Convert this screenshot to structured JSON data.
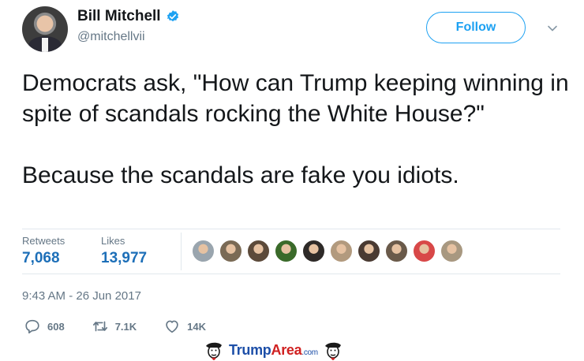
{
  "author": {
    "name": "Bill Mitchell",
    "handle": "@mitchellvii",
    "verified": true
  },
  "follow_label": "Follow",
  "tweet": {
    "paragraph1": "Democrats ask, \"How can Trump keeping winning in spite of scandals rocking the White House?\"",
    "paragraph2": "Because the scandals are fake you idiots."
  },
  "stats": {
    "retweets_label": "Retweets",
    "retweets_value": "7,068",
    "likes_label": "Likes",
    "likes_value": "13,977"
  },
  "liker_avatar_colors": [
    "#9aa5ae",
    "#7a6a55",
    "#5c4a3a",
    "#3a6a2a",
    "#2e2a28",
    "#b29a7e",
    "#4a3a32",
    "#6a5a4a",
    "#d84848",
    "#a89880"
  ],
  "timestamp": "9:43 AM - 26 Jun 2017",
  "actions": {
    "reply_count": "608",
    "retweet_count": "7.1K",
    "like_count": "14K"
  },
  "watermark": {
    "part1": "Trump",
    "part2": "Area",
    "part3": ".com"
  },
  "colors": {
    "accent": "#1da1f2",
    "stat_value": "#1d6fb8",
    "muted": "#657786"
  }
}
